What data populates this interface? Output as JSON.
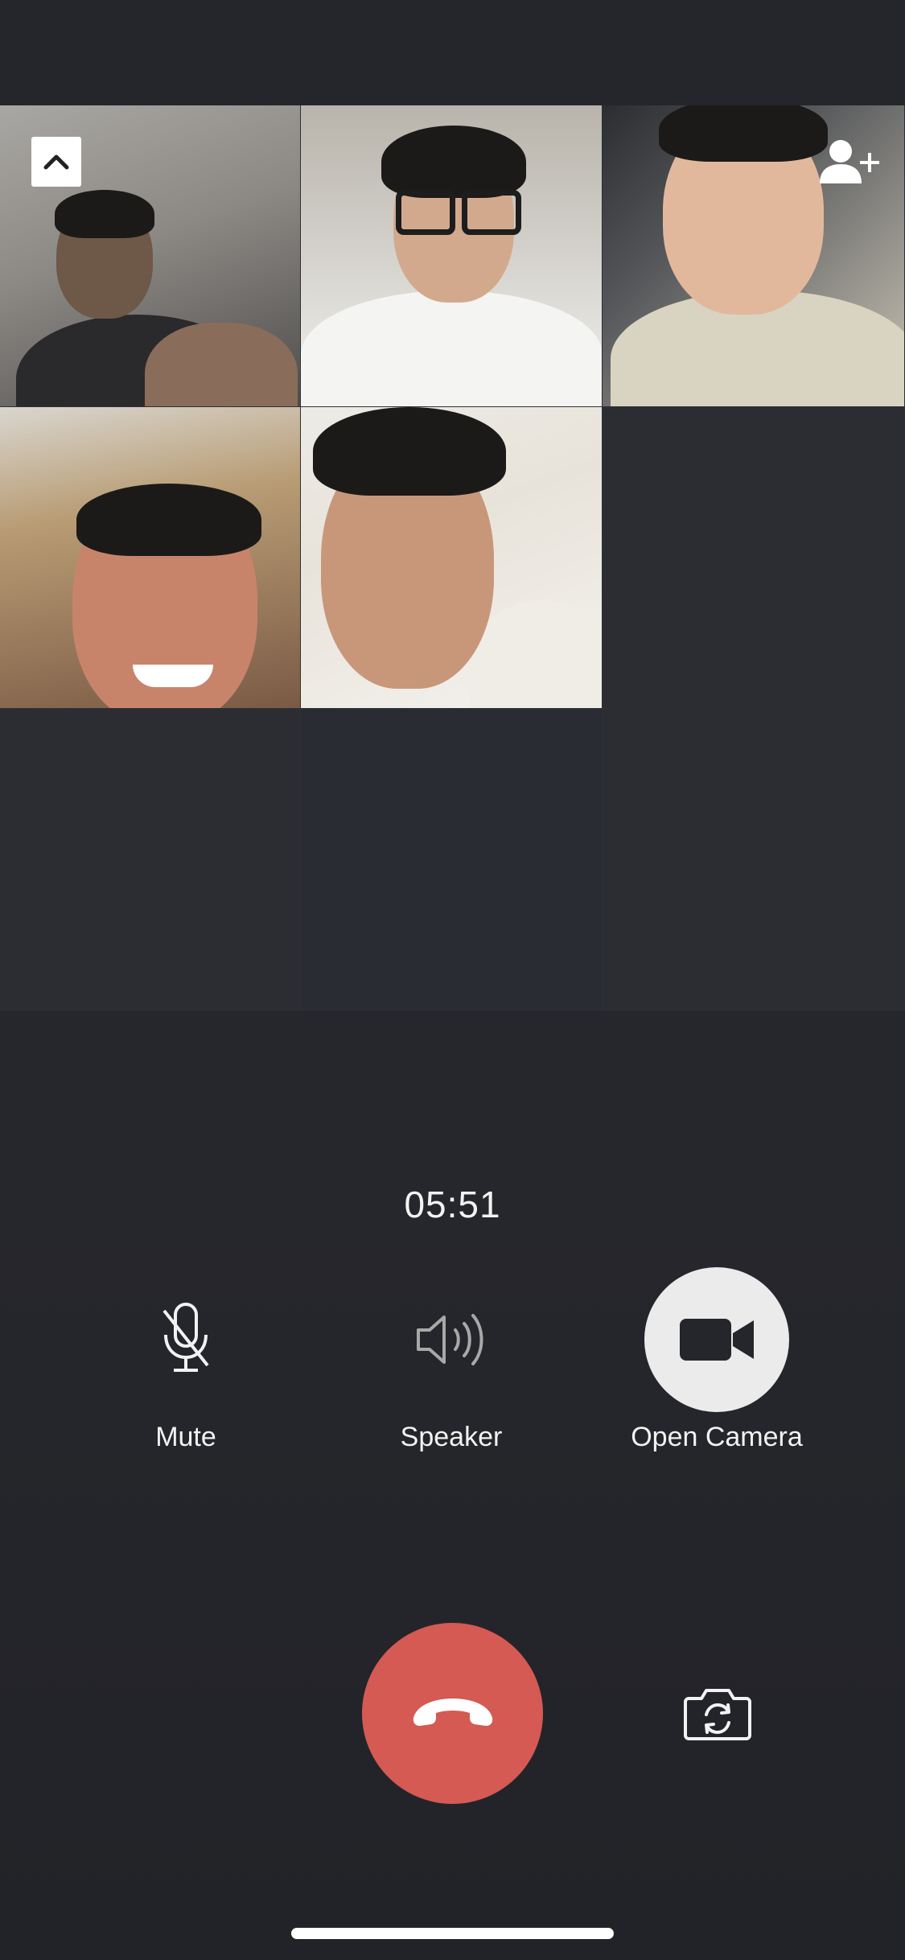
{
  "call": {
    "timer": "05:51"
  },
  "controls": {
    "mute_label": "Mute",
    "speaker_label": "Speaker",
    "camera_label": "Open Camera"
  },
  "icons": {
    "collapse": "chevron-up-icon",
    "add_participant": "add-person-icon",
    "mute": "microphone-muted-icon",
    "speaker": "speaker-icon",
    "camera": "video-camera-icon",
    "hangup": "phone-hangup-icon",
    "flip_camera": "camera-flip-icon"
  },
  "colors": {
    "background": "#25262b",
    "hangup": "#d45a53",
    "camera_button": "#ebebeb"
  },
  "grid": {
    "participants_with_video": 5,
    "empty_slots": 4
  }
}
